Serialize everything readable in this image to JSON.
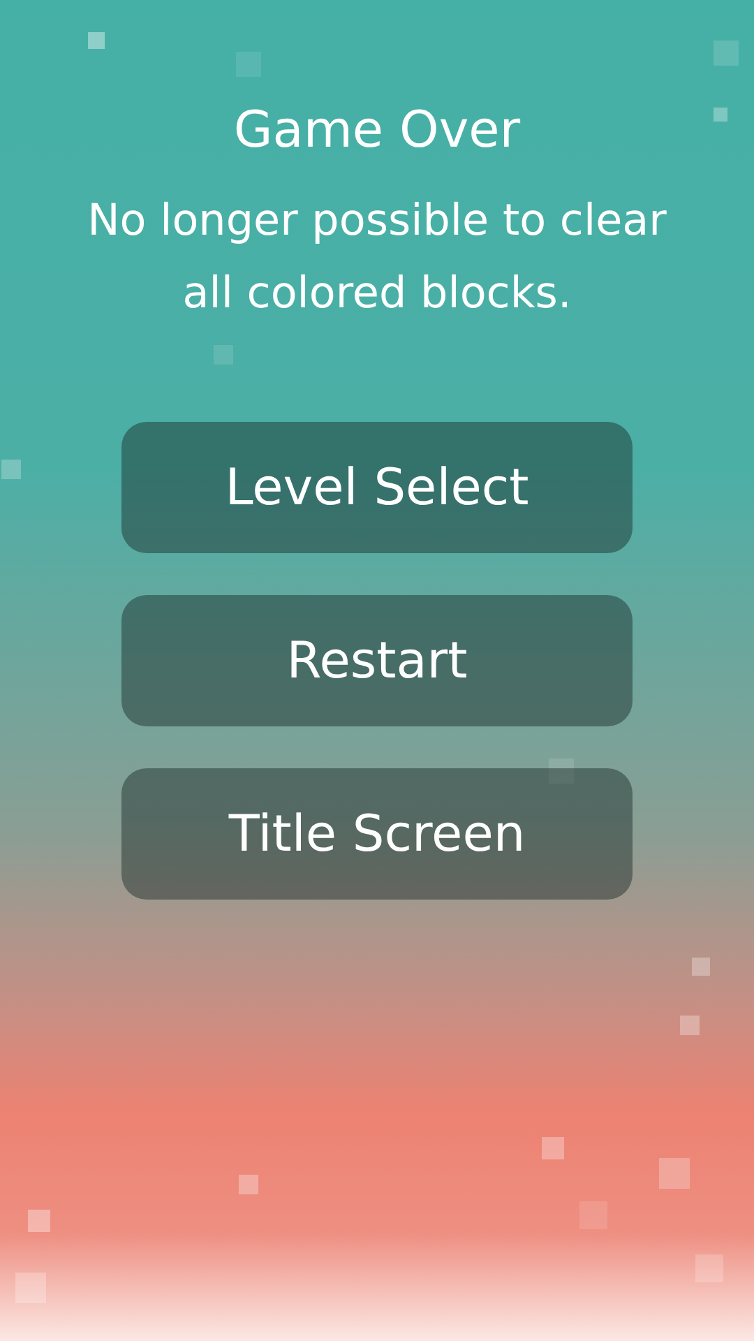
{
  "title": "Game Over",
  "message": "No longer possible to clear all colored blocks.",
  "buttons": [
    {
      "label": "Level Select"
    },
    {
      "label": "Restart"
    },
    {
      "label": "Title Screen"
    }
  ]
}
